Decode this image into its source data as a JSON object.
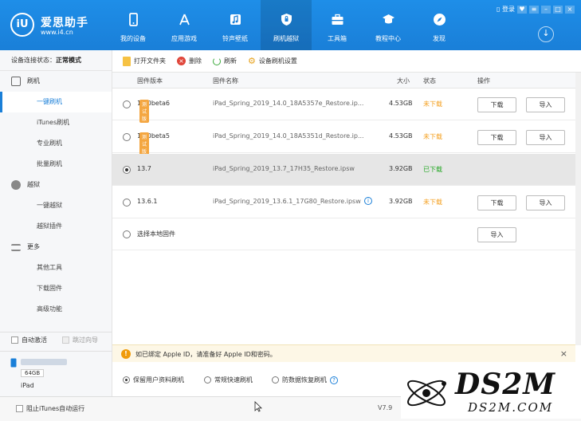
{
  "app": {
    "logo_mark": "iU",
    "name": "爱思助手",
    "url": "www.i4.cn"
  },
  "nav": [
    {
      "label": "我的设备",
      "icon": "phone-icon"
    },
    {
      "label": "应用游戏",
      "icon": "app-store-icon"
    },
    {
      "label": "铃声壁纸",
      "icon": "music-note-icon"
    },
    {
      "label": "刷机越狱",
      "icon": "shield-icon",
      "active": true
    },
    {
      "label": "工具箱",
      "icon": "toolbox-icon"
    },
    {
      "label": "教程中心",
      "icon": "graduation-cap-icon"
    },
    {
      "label": "发现",
      "icon": "compass-icon"
    }
  ],
  "window": {
    "login": "登录"
  },
  "sidebar": {
    "status_label": "设备连接状态：",
    "status_value": "正常模式",
    "sections": [
      {
        "label": "刷机",
        "items": [
          "一键刷机",
          "iTunes刷机",
          "专业刷机",
          "批量刷机"
        ]
      },
      {
        "label": "越狱",
        "items": [
          "一键越狱",
          "越狱插件"
        ]
      },
      {
        "label": "更多",
        "items": [
          "其他工具",
          "下载固件",
          "高级功能"
        ]
      }
    ],
    "auto_activate": "自动激活",
    "skip_guide": "跳过向导",
    "device_capacity": "64GB",
    "device_type": "iPad",
    "block_itunes": "阻止iTunes自动运行"
  },
  "toolbar": {
    "open_folder": "打开文件夹",
    "delete": "删除",
    "refresh": "刷新",
    "settings": "设备刷机设置"
  },
  "table": {
    "headers": [
      "固件版本",
      "固件名称",
      "大小",
      "状态",
      "操作"
    ],
    "rows": [
      {
        "version": "14.0beta6",
        "tag": "测试版",
        "name": "iPad_Spring_2019_14.0_18A5357e_Restore.ip...",
        "size": "4.53GB",
        "status": "未下载",
        "download": "下载",
        "import": "导入"
      },
      {
        "version": "14.0beta5",
        "tag": "测试版",
        "name": "iPad_Spring_2019_14.0_18A5351d_Restore.ip...",
        "size": "4.53GB",
        "status": "未下载",
        "download": "下载",
        "import": "导入"
      },
      {
        "version": "13.7",
        "name": "iPad_Spring_2019_13.7_17H35_Restore.ipsw",
        "size": "3.92GB",
        "status": "已下载"
      },
      {
        "version": "13.6.1",
        "name": "iPad_Spring_2019_13.6.1_17G80_Restore.ipsw",
        "size": "3.92GB",
        "status": "未下载",
        "download": "下载",
        "import": "导入"
      }
    ],
    "local_label": "选择本地固件",
    "local_import": "导入"
  },
  "notice": {
    "text": "如已绑定 Apple ID，请准备好 Apple ID和密码。",
    "close": "×"
  },
  "options": [
    "保留用户资料刷机",
    "常规快速刷机",
    "防数据恢复刷机"
  ],
  "version_text": "V7.9",
  "watermark": {
    "title": "DS2M",
    "sub": "DS2M.COM"
  }
}
